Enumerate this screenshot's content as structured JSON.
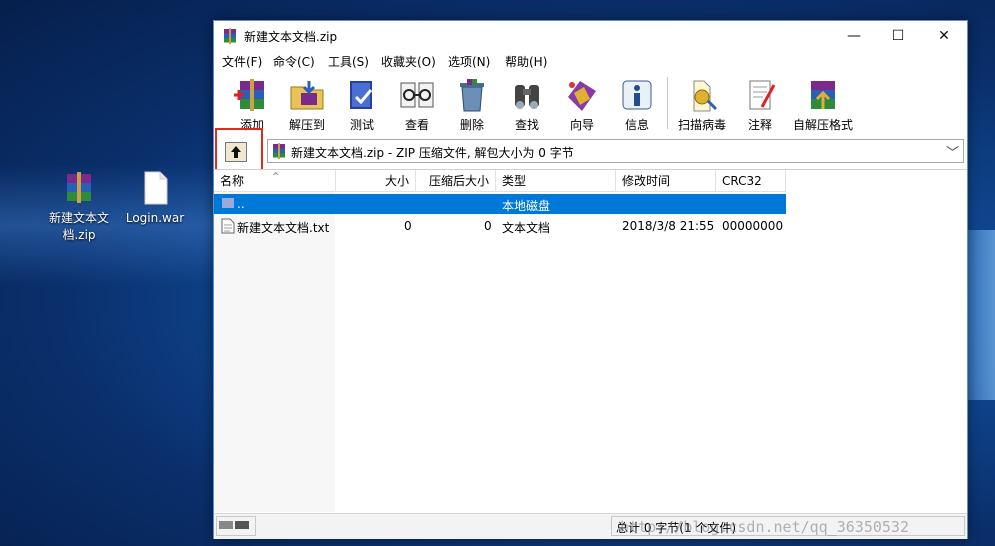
{
  "desktop": {
    "icons": [
      {
        "label": "新建文本文\n档.zip",
        "icon": "winrar-archive-icon"
      },
      {
        "label": "Login.war",
        "icon": "blank-file-icon"
      }
    ]
  },
  "window": {
    "title": "新建文本文档.zip",
    "controls": {
      "minimize": "—",
      "maximize": "☐",
      "close": "✕"
    }
  },
  "menubar": [
    "文件(F)",
    "命令(C)",
    "工具(S)",
    "收藏夹(O)",
    "选项(N)",
    "帮助(H)"
  ],
  "toolbar": [
    {
      "label": "添加",
      "icon": "add-archive-icon"
    },
    {
      "label": "解压到",
      "icon": "extract-to-icon"
    },
    {
      "label": "测试",
      "icon": "test-icon"
    },
    {
      "label": "查看",
      "icon": "view-icon"
    },
    {
      "label": "删除",
      "icon": "delete-icon"
    },
    {
      "label": "查找",
      "icon": "find-icon"
    },
    {
      "label": "向导",
      "icon": "wizard-icon"
    },
    {
      "label": "信息",
      "icon": "info-icon"
    },
    {
      "label": "扫描病毒",
      "icon": "virus-scan-icon"
    },
    {
      "label": "注释",
      "icon": "comment-icon"
    },
    {
      "label": "自解压格式",
      "icon": "sfx-icon"
    }
  ],
  "address": {
    "text": "新建文本文档.zip - ZIP 压缩文件, 解包大小为 0 字节",
    "up_icon": "up-folder-icon"
  },
  "columns": [
    "名称",
    "大小",
    "压缩后大小",
    "类型",
    "修改时间",
    "CRC32"
  ],
  "rows": [
    {
      "name": "..",
      "size": "",
      "packed": "",
      "type": "本地磁盘",
      "modified": "",
      "crc": "",
      "selected": true
    },
    {
      "name": "新建文本文档.txt",
      "size": "0",
      "packed": "0",
      "type": "文本文档",
      "modified": "2018/3/8 21:55",
      "crc": "00000000",
      "selected": false
    }
  ],
  "status": {
    "text": "总计 0 字节(1 个文件)"
  },
  "watermark": "http://blog.csdn.net/qq_36350532",
  "colors": {
    "selection": "#0078d7",
    "highlight_box": "#e02a1b"
  }
}
